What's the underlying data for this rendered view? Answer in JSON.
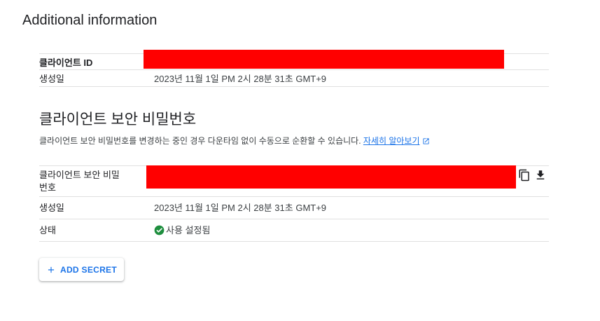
{
  "additional_info": {
    "title": "Additional information",
    "client_id_label": "클라이언트 ID",
    "created_label": "생성일",
    "created_value": "2023년 11월 1일 PM 2시 28분 31초 GMT+9"
  },
  "client_secret": {
    "title": "클라이언트 보안 비밀번호",
    "description": "클라이언트 보안 비밀번호를 변경하는 중인 경우 다운타임 없이 수동으로 순환할 수 있습니다.",
    "learn_more": "자세히 알아보기",
    "secret_label": "클라이언트 보안 비밀번호",
    "created_label": "생성일",
    "created_value": "2023년 11월 1일 PM 2시 28분 31초 GMT+9",
    "status_label": "상태",
    "status_value": "사용 설정됨",
    "status_color": "#1e8e3e"
  },
  "add_secret": {
    "label": "ADD SECRET"
  }
}
